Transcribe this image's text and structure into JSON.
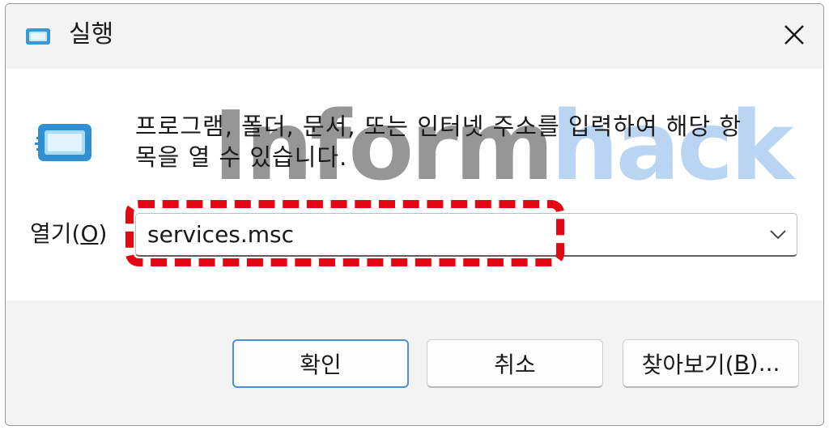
{
  "window": {
    "title": "실행",
    "icon": "run-icon",
    "close_icon": "close-icon"
  },
  "body": {
    "description_line1": "프로그램, 폴더, 문서, 또는 인터넷 주소를 입력하여 해당 항",
    "description_line2": "목을 열 수 있습니다.",
    "watermark_part1": "Inform",
    "watermark_part2": "hack",
    "open_label_prefix": "열기(",
    "open_label_mnemonic": "O",
    "open_label_suffix": ")",
    "open_value": "services.msc",
    "dropdown_icon": "chevron-down-icon",
    "highlight_color": "#e30613"
  },
  "buttons": {
    "ok": "확인",
    "cancel": "취소",
    "browse_prefix": "찾아보기(",
    "browse_mnemonic": "B",
    "browse_suffix": ")..."
  },
  "colors": {
    "accent": "#4c8fd6",
    "watermark_gray": "#6e6e6e",
    "watermark_blue": "#9fc6ee"
  }
}
